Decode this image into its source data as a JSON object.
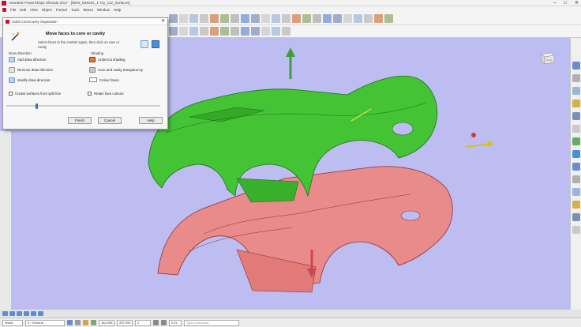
{
  "window": {
    "title": "Autodesk PowerShape Ultimate 2017 - [NEW_MODEL_1 Toy_Car_Surfaces]",
    "controls": [
      "–",
      "□",
      "✕"
    ]
  },
  "menu": [
    "File",
    "Edit",
    "View",
    "Object",
    "Format",
    "Tools",
    "Macro",
    "Window",
    "Help"
  ],
  "dialog": {
    "title": "Solid Core/Cavity Separation",
    "close_label": "✕",
    "heading": "Move faces to core or cavity",
    "description": "Select faces in the central region, then click on core or cavity",
    "draw_direction_label": "Draw Direction",
    "add_draw_direction": "Add draw direction",
    "remove_draw_direction": "Remove draw direction",
    "modify_draw_direction": "Modify draw direction",
    "shading_label": "Shading",
    "undercut_shading": "Undercut shading",
    "core_cavity_transparency": "Core and cavity transparency",
    "colour_faces": "Colour faces",
    "create_surfaces": "Create surfaces from split line",
    "retain_colours": "Retain face colours",
    "finish_label": "Finish",
    "cancel_label": "Cancel",
    "help_label": "Help",
    "slider_value": 0.2
  },
  "viewcube": {
    "label": "Front"
  },
  "statusbar": {
    "workplane": "World",
    "level": "0 : General",
    "x_coord": "182.098",
    "y_coord": "287.093",
    "z_coord": "0",
    "tolerance": "0.01",
    "command_placeholder": "Type Command"
  },
  "colors": {
    "viewport_bg": "#bdbdf2",
    "cavity": "#3fbf2f",
    "core": "#e98a8a",
    "arrow_green": "#3e9e3e",
    "arrow_red": "#c84a4a",
    "accent_red": "#c8102e"
  },
  "icons": {
    "wand": "wand-icon",
    "draw_direction": "draw-direction-icon",
    "undercut": "undercut-icon",
    "transparency": "transparency-icon"
  }
}
